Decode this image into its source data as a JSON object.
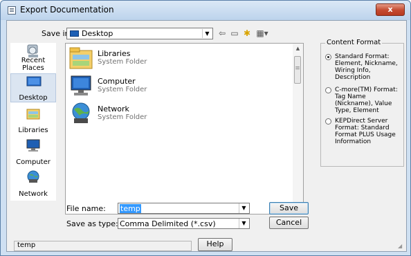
{
  "window": {
    "title": "Export Documentation",
    "close_label": "x"
  },
  "save_in": {
    "label": "Save in:",
    "value": "Desktop"
  },
  "toolbar": {
    "back_glyph": "⇦",
    "up_glyph": "▭",
    "new_folder_glyph": "✱",
    "views_glyph": "▦▾"
  },
  "places": [
    {
      "label": "Recent Places"
    },
    {
      "label": "Desktop"
    },
    {
      "label": "Libraries"
    },
    {
      "label": "Computer"
    },
    {
      "label": "Network"
    }
  ],
  "files": [
    {
      "name": "Libraries",
      "type": "System Folder"
    },
    {
      "name": "Computer",
      "type": "System Folder"
    },
    {
      "name": "Network",
      "type": "System Folder"
    }
  ],
  "file_name": {
    "label": "File name:",
    "value": "temp"
  },
  "save_as_type": {
    "label": "Save as type:",
    "value": "Comma Delimited (*.csv)"
  },
  "buttons": {
    "save": "Save",
    "cancel": "Cancel",
    "help": "Help"
  },
  "content_format": {
    "title": "Content Format",
    "options": [
      {
        "text": "Standard Format: Element, Nickname, Wiring Info, Description",
        "selected": true
      },
      {
        "text": "C-more(TM) Format: Tag Name (Nickname), Value Type, Element",
        "selected": false
      },
      {
        "text": "KEPDirect Server Format: Standard Format PLUS Usage Information",
        "selected": false
      }
    ]
  },
  "status": {
    "text": "temp"
  }
}
